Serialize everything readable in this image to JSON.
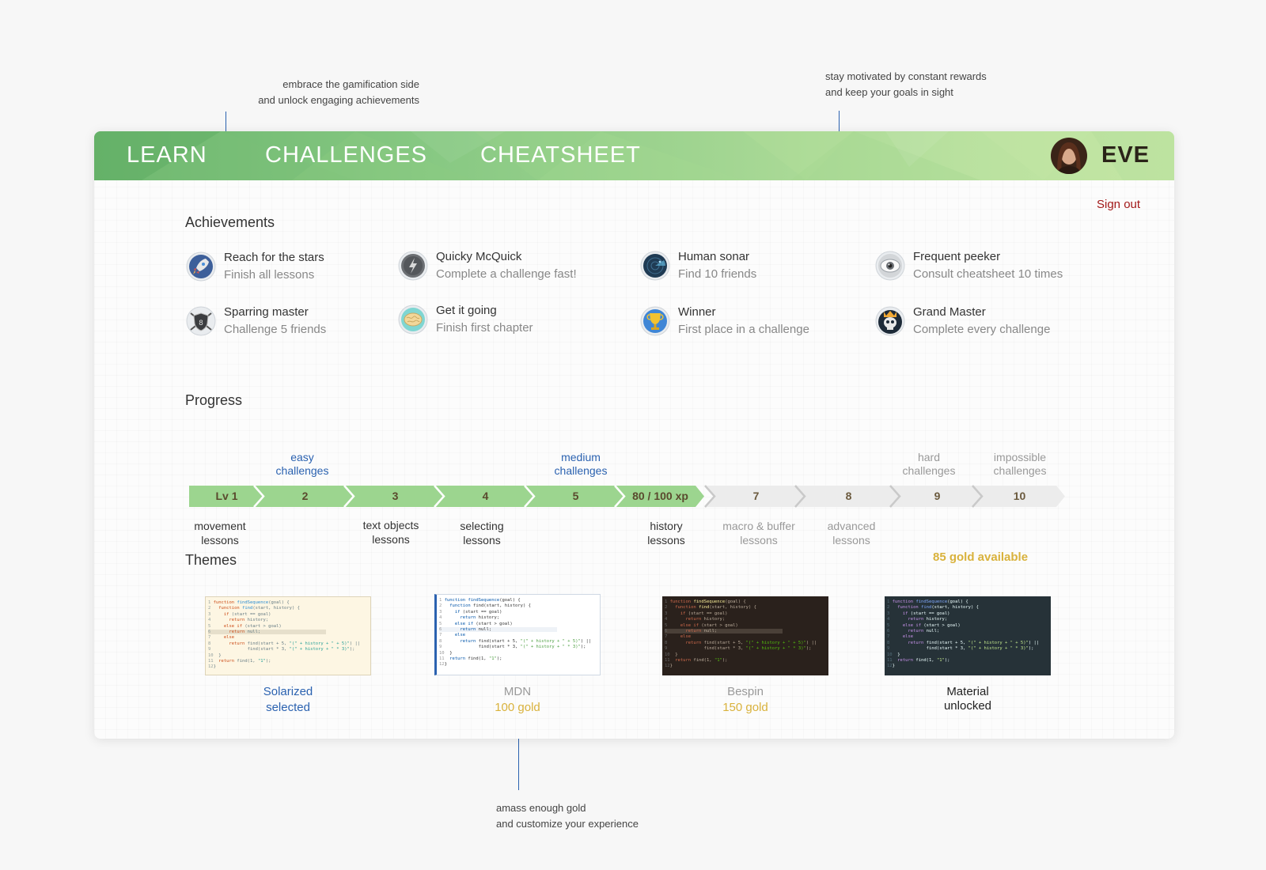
{
  "annotations": {
    "a1": {
      "line1": "embrace the gamification side",
      "line2": "and unlock engaging achievements"
    },
    "a2": {
      "line1": "stay motivated by constant rewards",
      "line2": "and keep your goals in sight"
    },
    "a3": {
      "line1": "amass enough gold",
      "line2": "and customize your experience"
    }
  },
  "nav": {
    "learn": "LEARN",
    "challenges": "CHALLENGES",
    "cheatsheet": "CHEATSHEET",
    "username": "EVE",
    "sign_out": "Sign out"
  },
  "sections": {
    "achievements": "Achievements",
    "progress": "Progress",
    "themes": "Themes"
  },
  "achievements": [
    {
      "title": "Reach for the stars",
      "desc": "Finish all lessons",
      "icon": "rocket-icon"
    },
    {
      "title": "Quicky McQuick",
      "desc": "Complete a challenge fast!",
      "icon": "lightning-icon"
    },
    {
      "title": "Human sonar",
      "desc": "Find 10 friends",
      "icon": "radar-icon"
    },
    {
      "title": "Frequent peeker",
      "desc": "Consult cheatsheet 10 times",
      "icon": "eye-icon"
    },
    {
      "title": "Sparring master",
      "desc": "Challenge 5 friends",
      "icon": "shield-swords-icon"
    },
    {
      "title": "Get it going",
      "desc": "Finish first chapter",
      "icon": "brain-icon"
    },
    {
      "title": "Winner",
      "desc": "First place in a challenge",
      "icon": "trophy-icon"
    },
    {
      "title": "Grand Master",
      "desc": "Complete every challenge",
      "icon": "crowned-skull-icon"
    }
  ],
  "progress": {
    "levels": [
      "Lv 1",
      "2",
      "3",
      "4",
      "5",
      "80 / 100 xp",
      "7",
      "8",
      "9",
      "10"
    ],
    "completed_count": 6,
    "bands": {
      "easy": [
        "easy",
        "challenges"
      ],
      "medium": [
        "medium",
        "challenges"
      ],
      "hard": [
        "hard",
        "challenges"
      ],
      "impossible": [
        "impossible",
        "challenges"
      ]
    },
    "lessons": {
      "movement": [
        "movement",
        "lessons"
      ],
      "text_objects": [
        "text objects",
        "lessons"
      ],
      "selecting": [
        "selecting",
        "lessons"
      ],
      "history": [
        "history",
        "lessons"
      ],
      "macro": [
        "macro & buffer",
        "lessons"
      ],
      "advanced": [
        "advanced",
        "lessons"
      ]
    }
  },
  "themes": {
    "gold_available": "85 gold available",
    "items": [
      {
        "name": "Solarized",
        "status": "selected"
      },
      {
        "name": "MDN",
        "status": "100 gold"
      },
      {
        "name": "Bespin",
        "status": "150 gold"
      },
      {
        "name": "Material",
        "status": "unlocked"
      }
    ]
  },
  "colors": {
    "accent_blue": "#2b62b0",
    "gold": "#d9b23c",
    "progress_green": "#9cd58f",
    "sign_out_red": "#a21818"
  }
}
